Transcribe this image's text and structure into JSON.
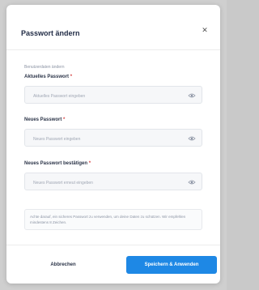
{
  "dialog": {
    "title": "Passwort ändern",
    "close_icon": "close-icon",
    "section_hint": "Benutzerdaten ändern"
  },
  "fields": [
    {
      "label": "Aktuelles Passwort",
      "required_mark": "*",
      "placeholder": "Aktuelles Passwort eingeben",
      "icon": "eye-icon"
    },
    {
      "label": "Neues Passwort",
      "required_mark": "*",
      "placeholder": "Neues Passwort eingeben",
      "icon": "eye-icon"
    },
    {
      "label": "Neues Passwort bestätigen",
      "required_mark": "*",
      "placeholder": "Neues Passwort erneut eingeben",
      "icon": "eye-icon"
    }
  ],
  "note": "Achte darauf, ein sicheres Passwort zu verwenden, um deine Daten zu schützen. Wir empfehlen mindestens 8 Zeichen.",
  "buttons": {
    "cancel_label": "Abbrechen",
    "save_label": "Speichern & Anwenden"
  },
  "colors": {
    "accent": "#1e88e5",
    "required": "#d64545"
  }
}
